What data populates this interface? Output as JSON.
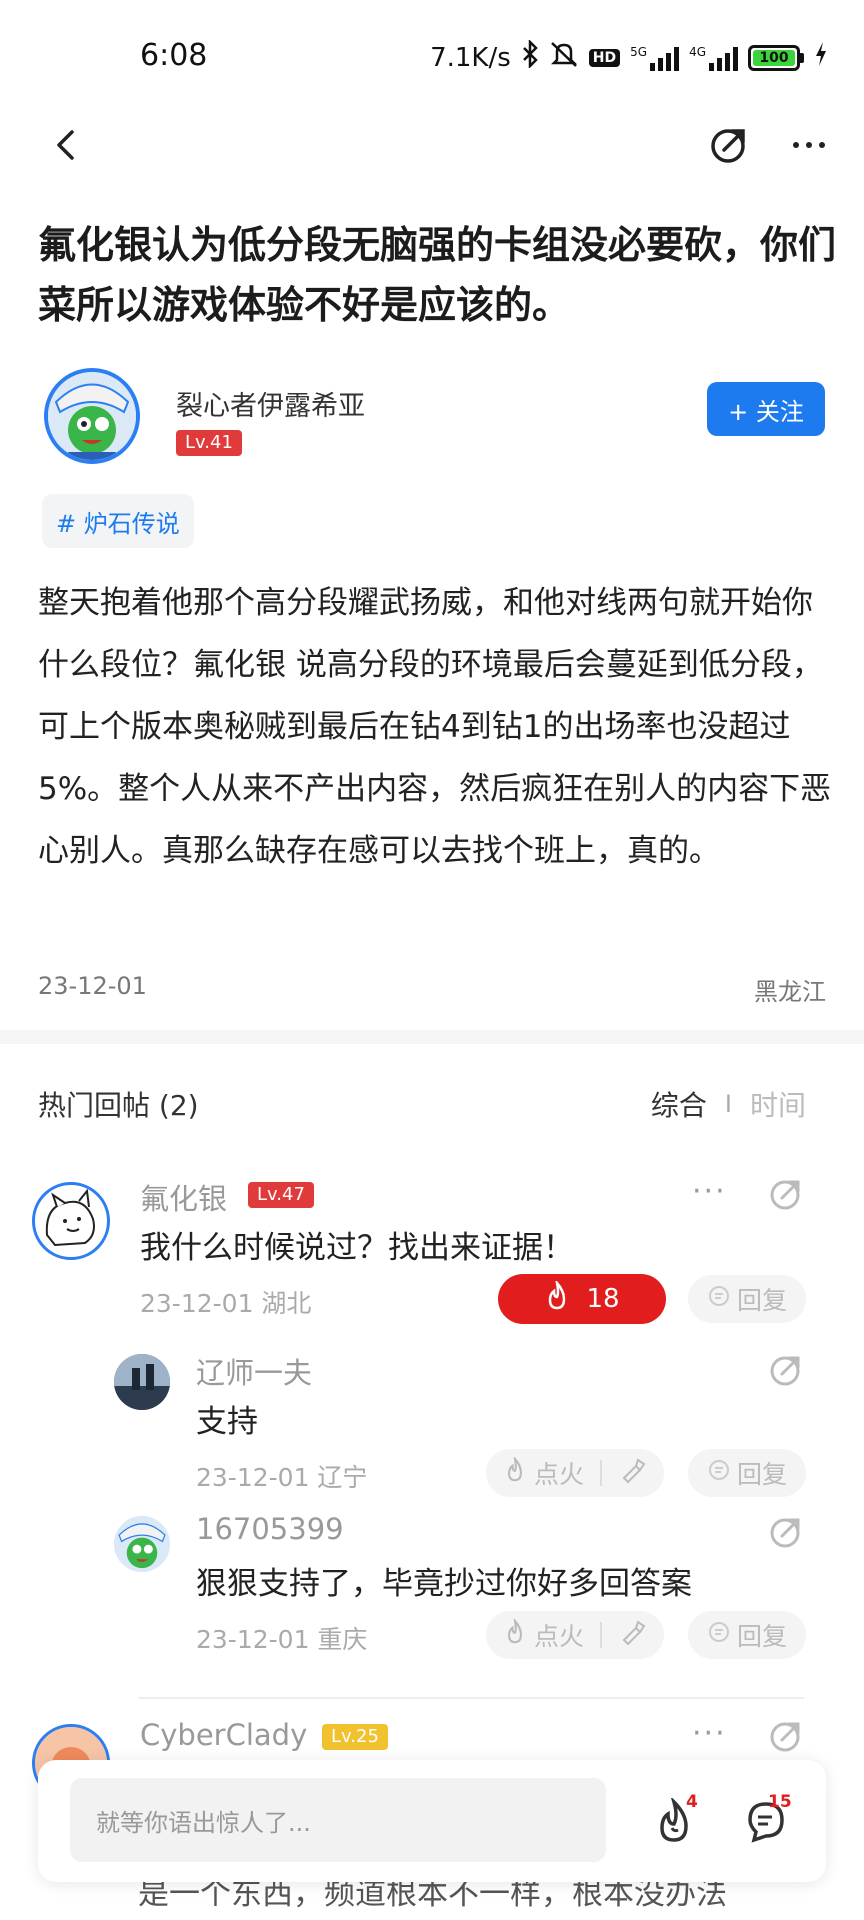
{
  "status_bar": {
    "time": "6:08",
    "net_speed": "7.1K/s",
    "hd": "HD",
    "sig1_label": "5G",
    "sig2_label": "4G",
    "battery": "100"
  },
  "nav": {
    "back_icon": "chevron-left-icon",
    "share_icon": "share-icon",
    "more_icon": "more-icon"
  },
  "post": {
    "title": "氟化银认为低分段无脑强的卡组没必要砍，你们菜所以游戏体验不好是应该的。",
    "author": {
      "name": "裂心者伊露希亚",
      "level": "Lv.41"
    },
    "follow_label": "+ 关注",
    "tag": "# 炉石传说",
    "body": "整天抱着他那个高分段耀武扬威，和他对线两句就开始你什么段位？氟化银 说高分段的环境最后会蔓延到低分段，可上个版本奥秘贼到最后在钻4到钻1的出场率也没超过5%。整个人从来不产出内容，然后疯狂在别人的内容下恶心别人。真那么缺存在感可以去找个班上，真的。",
    "date": "23-12-01",
    "location": "黑龙江"
  },
  "replies_header": {
    "title": "热门回帖 (2)",
    "sort_active": "综合",
    "sort_sep": "I",
    "sort_inactive": "时间"
  },
  "comments": [
    {
      "name": "氟化银",
      "level": "Lv.47",
      "text": "我什么时候说过？找出来证据！",
      "meta": "23-12-01  湖北",
      "fire_count": "18",
      "reply_label": "回复",
      "more": "···",
      "sub_replies": [
        {
          "name": "辽师一夫",
          "text": "支持",
          "meta": "23-12-01  辽宁",
          "fire_label": "点火",
          "reply_label": "回复"
        },
        {
          "name": "16705399",
          "text": "狠狠支持了，毕竟抄过你好多回答案",
          "meta": "23-12-01  重庆",
          "fire_label": "点火",
          "reply_label": "回复"
        }
      ]
    },
    {
      "name": "CyberClady",
      "level": "Lv.25",
      "more": "···",
      "partial_text": "是一个东西，频道根本不一样，根本没办法"
    }
  ],
  "bottom_bar": {
    "placeholder": "就等你语出惊人了...",
    "fire_count": "4",
    "comment_count": "15"
  }
}
